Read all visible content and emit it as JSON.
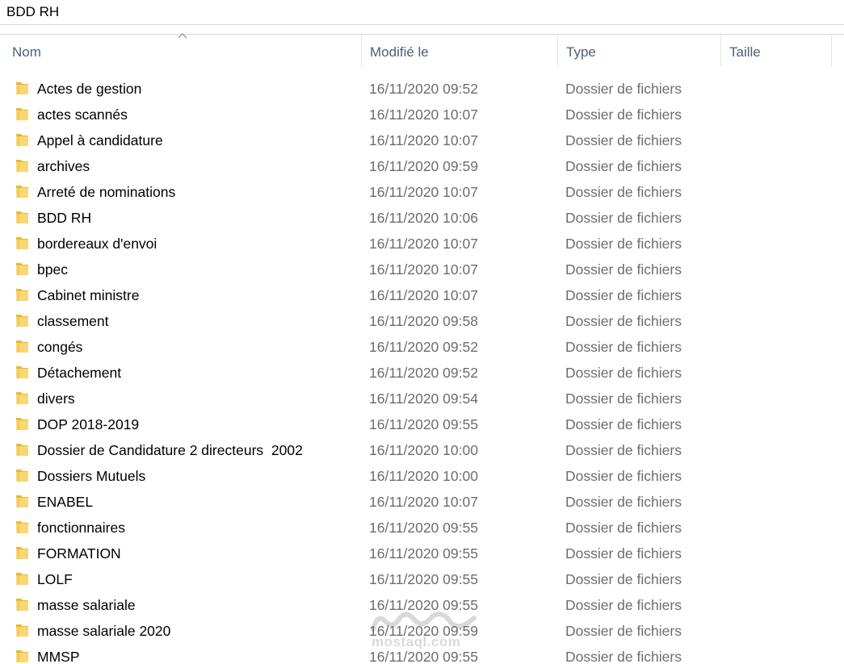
{
  "window": {
    "title": "BDD RH"
  },
  "columns": {
    "name": "Nom",
    "modified": "Modifié le",
    "type": "Type",
    "size": "Taille"
  },
  "icons": {
    "folder": "folder-icon",
    "sort": "sort-ascending-icon"
  },
  "colors": {
    "folder": "#f8d775",
    "folder_dark": "#e8b931",
    "header_text": "#4c607a",
    "secondary_text": "#6d6d6d"
  },
  "files": [
    {
      "name": "Actes de gestion",
      "modified": "16/11/2020 09:52",
      "type": "Dossier de fichiers"
    },
    {
      "name": "actes scannés",
      "modified": "16/11/2020 10:07",
      "type": "Dossier de fichiers"
    },
    {
      "name": "Appel à candidature",
      "modified": "16/11/2020 10:07",
      "type": "Dossier de fichiers"
    },
    {
      "name": "archives",
      "modified": "16/11/2020 09:59",
      "type": "Dossier de fichiers"
    },
    {
      "name": "Arreté de nominations",
      "modified": "16/11/2020 10:07",
      "type": "Dossier de fichiers"
    },
    {
      "name": "BDD RH",
      "modified": "16/11/2020 10:06",
      "type": "Dossier de fichiers"
    },
    {
      "name": "bordereaux d'envoi",
      "modified": "16/11/2020 10:07",
      "type": "Dossier de fichiers"
    },
    {
      "name": "bpec",
      "modified": "16/11/2020 10:07",
      "type": "Dossier de fichiers"
    },
    {
      "name": "Cabinet ministre",
      "modified": "16/11/2020 10:07",
      "type": "Dossier de fichiers"
    },
    {
      "name": "classement",
      "modified": "16/11/2020 09:58",
      "type": "Dossier de fichiers"
    },
    {
      "name": "congés",
      "modified": "16/11/2020 09:52",
      "type": "Dossier de fichiers"
    },
    {
      "name": "Détachement",
      "modified": "16/11/2020 09:52",
      "type": "Dossier de fichiers"
    },
    {
      "name": "divers",
      "modified": "16/11/2020 09:54",
      "type": "Dossier de fichiers"
    },
    {
      "name": "DOP 2018-2019",
      "modified": "16/11/2020 09:55",
      "type": "Dossier de fichiers"
    },
    {
      "name": "Dossier de Candidature 2 directeurs  2002",
      "modified": "16/11/2020 10:00",
      "type": "Dossier de fichiers"
    },
    {
      "name": "Dossiers Mutuels",
      "modified": "16/11/2020 10:00",
      "type": "Dossier de fichiers"
    },
    {
      "name": "ENABEL",
      "modified": "16/11/2020 10:07",
      "type": "Dossier de fichiers"
    },
    {
      "name": "fonctionnaires",
      "modified": "16/11/2020 09:55",
      "type": "Dossier de fichiers"
    },
    {
      "name": "FORMATION",
      "modified": "16/11/2020 09:55",
      "type": "Dossier de fichiers"
    },
    {
      "name": "LOLF",
      "modified": "16/11/2020 09:55",
      "type": "Dossier de fichiers"
    },
    {
      "name": "masse salariale",
      "modified": "16/11/2020 09:55",
      "type": "Dossier de fichiers"
    },
    {
      "name": "masse salariale 2020",
      "modified": "16/11/2020 09:59",
      "type": "Dossier de fichiers"
    },
    {
      "name": "MMSP",
      "modified": "16/11/2020 09:55",
      "type": "Dossier de fichiers"
    }
  ],
  "watermark": {
    "text": "mostaql.com"
  }
}
